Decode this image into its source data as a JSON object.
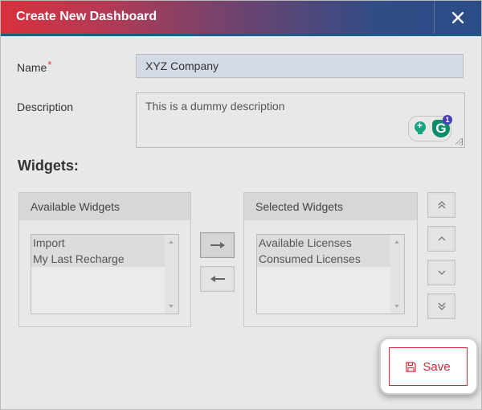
{
  "dialog": {
    "title": "Create New Dashboard",
    "close_icon": "close-icon"
  },
  "form": {
    "name_label": "Name",
    "required_marker": "*",
    "name_value": "XYZ Company",
    "description_label": "Description",
    "description_value": "This is a dummy description",
    "grammarly_badge_count": "1"
  },
  "widgets": {
    "section_title": "Widgets:",
    "available": {
      "header": "Available Widgets",
      "items": [
        "Import",
        "My Last Recharge"
      ]
    },
    "selected": {
      "header": "Selected Widgets",
      "items": [
        "Available Licenses",
        "Consumed Licenses"
      ]
    },
    "transfer_buttons": [
      "arrow-right-icon",
      "arrow-left-icon"
    ],
    "order_buttons": [
      "double-chevron-up-icon",
      "chevron-up-icon",
      "chevron-down-icon",
      "double-chevron-down-icon"
    ]
  },
  "actions": {
    "save_label": "Save",
    "save_icon": "floppy-disk-icon"
  },
  "colors": {
    "title_gradient_start": "#d9303d",
    "title_gradient_end": "#2a4d88",
    "accent_red": "#d42a3c"
  }
}
